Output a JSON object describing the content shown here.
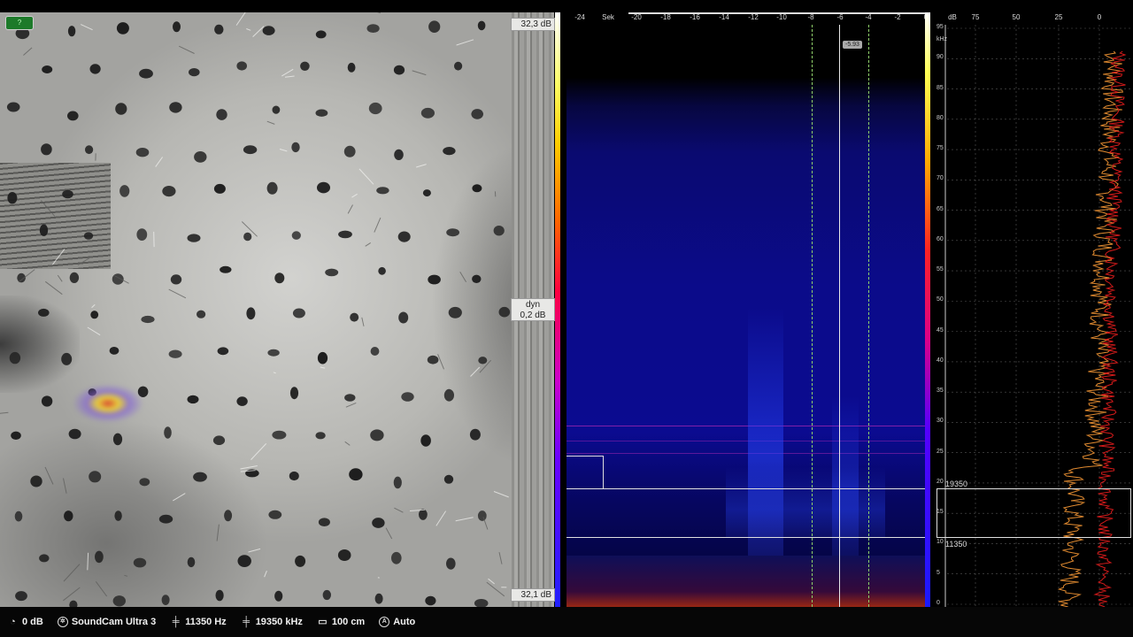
{
  "camera": {
    "indicator_label": "?",
    "db_max": "32,3 dB",
    "db_min": "32,1 dB",
    "dyn_label": "dyn",
    "dyn_value": "0,2 dB"
  },
  "spectrogram": {
    "time_unit": "Sek",
    "time_ticks": [
      "-24",
      "-20",
      "-18",
      "-16",
      "-14",
      "-12",
      "-10",
      "-8",
      "-6",
      "-4",
      "-2",
      "0"
    ],
    "cursor_value": "-5.93"
  },
  "spectrum": {
    "db_unit": "dB",
    "db_ticks": [
      "75",
      "50",
      "25",
      "0"
    ],
    "freq_unit": "kHz",
    "freq_ticks": [
      "95",
      "90",
      "85",
      "80",
      "75",
      "70",
      "65",
      "60",
      "55",
      "50",
      "45",
      "40",
      "35",
      "30",
      "25",
      "20",
      "15",
      "10",
      "5",
      "0"
    ],
    "band_high": "19350",
    "band_low": "11350"
  },
  "statusbar": {
    "gain": "0 dB",
    "device": "SoundCam Ultra 3",
    "freq_low": "11350 Hz",
    "freq_high": "19350 kHz",
    "distance": "100 cm",
    "mode": "Auto"
  },
  "colors": {
    "band_line": "#e0e0e0",
    "trace_orange": "#e08a30",
    "trace_red": "#d21a1a",
    "spectrogram_blue": "#0b0b8a",
    "indicator_green": "#1d7a2a"
  }
}
